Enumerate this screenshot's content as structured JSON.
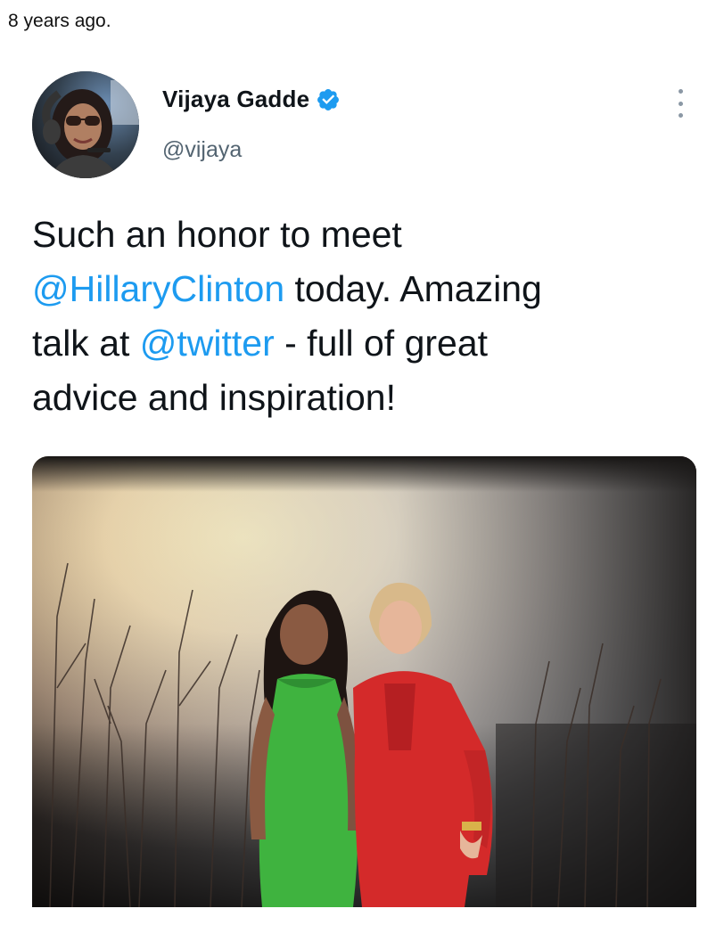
{
  "post": {
    "time_ago": "8 years ago."
  },
  "tweet": {
    "author": {
      "name": "Vijaya Gadde",
      "handle": "@vijaya",
      "verified": true,
      "avatar": "profile-photo"
    },
    "text": {
      "line1": "Such an honor to meet",
      "mention1": "@HillaryClinton",
      "line2_rest": " today. Amazing",
      "line3_start": "talk at ",
      "mention2": "@twitter",
      "line3_rest": " - full of great",
      "line4": "advice and inspiration!"
    },
    "menu_icon": "more-vertical-icon",
    "verified_icon": "verified-badge-icon",
    "photo": "photo-two-women-posing",
    "colors": {
      "mention": "#1d9bf0",
      "verified": "#1d9bf0",
      "handle": "#536471"
    }
  }
}
